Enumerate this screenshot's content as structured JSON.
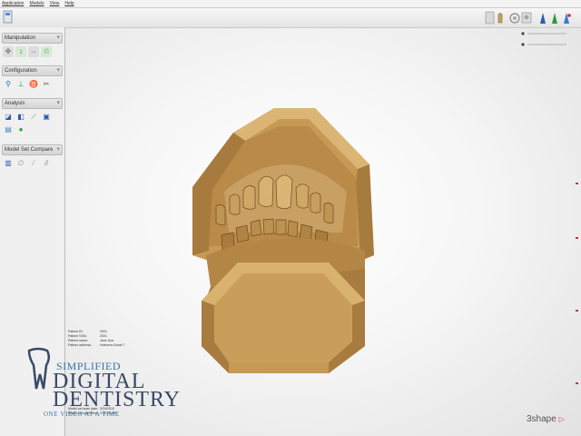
{
  "menu": [
    "Application",
    "Models",
    "View",
    "Help"
  ],
  "sidebar": {
    "panels": [
      {
        "title": "Manipulation"
      },
      {
        "title": "Configuration"
      },
      {
        "title": "Analysis"
      },
      {
        "title": "Model Set Compare"
      }
    ]
  },
  "patient_info": [
    {
      "key": "Patient ID:",
      "value": "2001"
    },
    {
      "key": "Patient SSN:",
      "value": "2001"
    },
    {
      "key": "Patient name:",
      "value": "Jane Doe"
    },
    {
      "key": "Patient address:",
      "value": "Holmens Kanal 7"
    },
    {
      "key": "Model set scan date:",
      "value": "3/24/2010"
    },
    {
      "key": "Model set scan time:",
      "value": "2:30:25 PM"
    }
  ],
  "watermark": {
    "line1": "SIMPLIFIED",
    "line2a": "DIGITAL",
    "line2b": "DENTISTRY",
    "line3": "ONE VIDEO AT A TIME"
  },
  "brand": "3shape",
  "colors": {
    "model": "#c69a55",
    "model_dark": "#8a6230",
    "model_light": "#dcb574",
    "accent_green": "#2e9a3c",
    "accent_blue": "#2a5db0",
    "accent_red": "#d03030"
  }
}
